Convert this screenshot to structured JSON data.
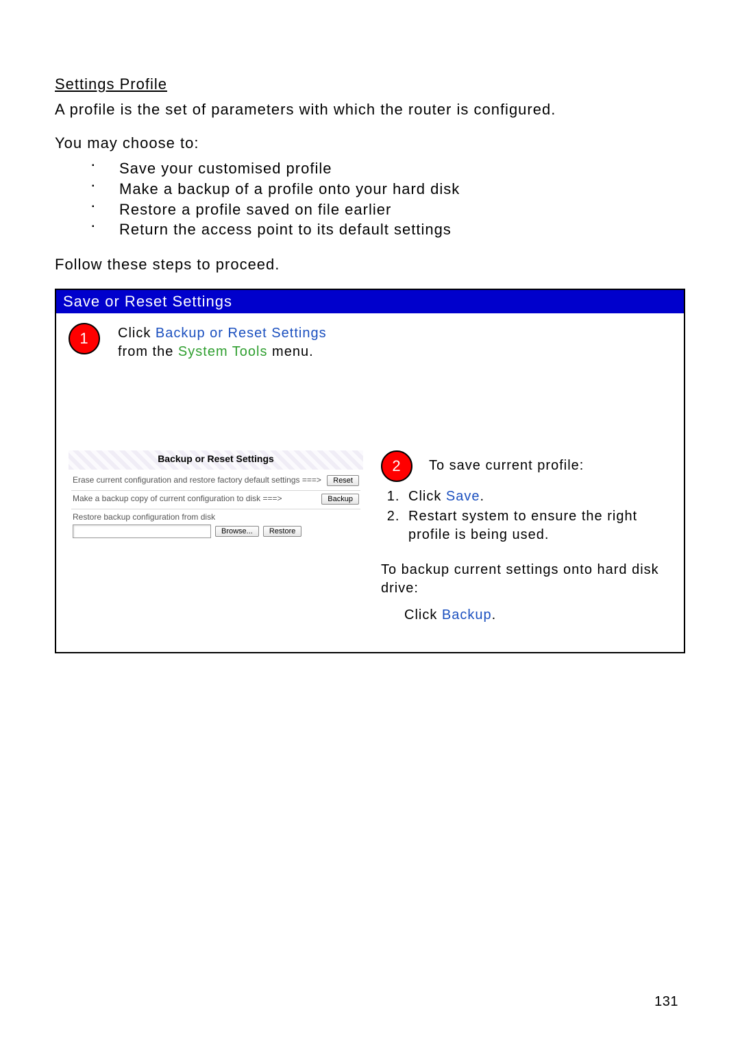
{
  "title": "Settings Profile",
  "intro": "A profile is the set of parameters with which the router is configured.",
  "choose_intro": "You may choose to:",
  "choices": [
    "Save your customised profile",
    "Make a backup of a profile onto your hard disk",
    "Restore a profile saved on file earlier",
    "Return the access point to its default settings"
  ],
  "follow": "Follow these steps to proceed.",
  "box_header": "Save or Reset Settings",
  "step1": {
    "num": "1",
    "click": "Click ",
    "link": "Backup or Reset Settings",
    "from": " from the ",
    "menu": "System Tools",
    "tail": " menu."
  },
  "panel": {
    "title": "Backup or Reset Settings",
    "row1_label": "Erase current configuration and restore factory default settings ===>",
    "row1_btn": "Reset",
    "row2_label": "Make a backup copy of current configuration to disk ===>",
    "row2_btn": "Backup",
    "row3_label": "Restore backup configuration from disk",
    "row3_browse": "Browse...",
    "row3_restore": "Restore"
  },
  "step2": {
    "num": "2",
    "save_intro": "To save current profile:",
    "ol1_pre": "Click ",
    "ol1_link": "Save",
    "ol1_post": ".",
    "ol2": "Restart system to ensure the right profile is being used.",
    "backup_intro": "To backup current settings onto hard disk drive:",
    "backup_pre": "Click ",
    "backup_link": "Backup",
    "backup_post": "."
  },
  "pagenum": "131"
}
